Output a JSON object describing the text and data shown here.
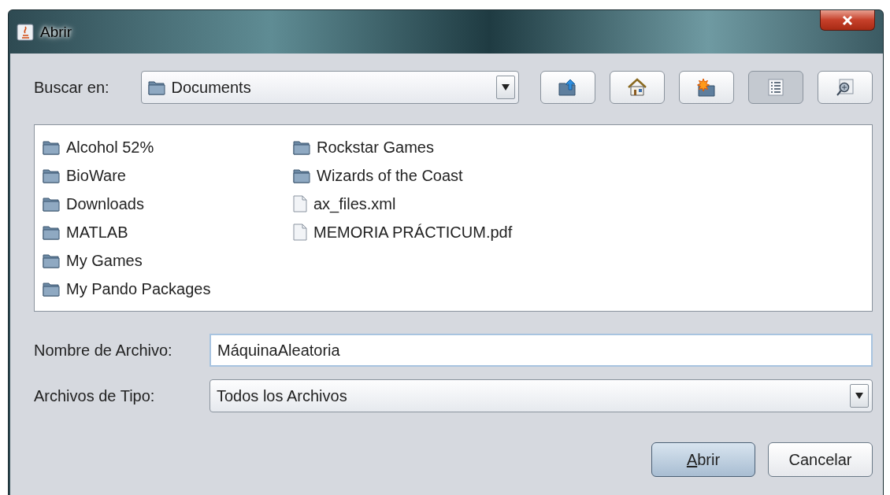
{
  "window": {
    "title": "Abrir"
  },
  "look_in": {
    "label": "Buscar en:",
    "value": "Documents"
  },
  "toolbar": [
    {
      "kind": "up",
      "selected": false
    },
    {
      "kind": "home",
      "selected": false
    },
    {
      "kind": "new-folder",
      "selected": false
    },
    {
      "kind": "list",
      "selected": true
    },
    {
      "kind": "details",
      "selected": false
    }
  ],
  "files": [
    {
      "name": "Alcohol 52%",
      "kind": "folder"
    },
    {
      "name": "BioWare",
      "kind": "folder"
    },
    {
      "name": "Downloads",
      "kind": "folder"
    },
    {
      "name": "MATLAB",
      "kind": "folder"
    },
    {
      "name": "My Games",
      "kind": "folder"
    },
    {
      "name": "My Pando Packages",
      "kind": "folder"
    },
    {
      "name": "Rockstar Games",
      "kind": "folder"
    },
    {
      "name": "Wizards of the Coast",
      "kind": "folder"
    },
    {
      "name": "ax_files.xml",
      "kind": "file"
    },
    {
      "name": "MEMORIA PRÁCTICUM.pdf",
      "kind": "file"
    }
  ],
  "file_name": {
    "label": "Nombre de Archivo:",
    "value": "MáquinaAleatoria"
  },
  "file_type": {
    "label": "Archivos de Tipo:",
    "value": "Todos los Archivos"
  },
  "buttons": [
    {
      "label": "Abrir",
      "mnemonic_first_letter": true,
      "default": true
    },
    {
      "label": "Cancelar",
      "default": false
    }
  ]
}
